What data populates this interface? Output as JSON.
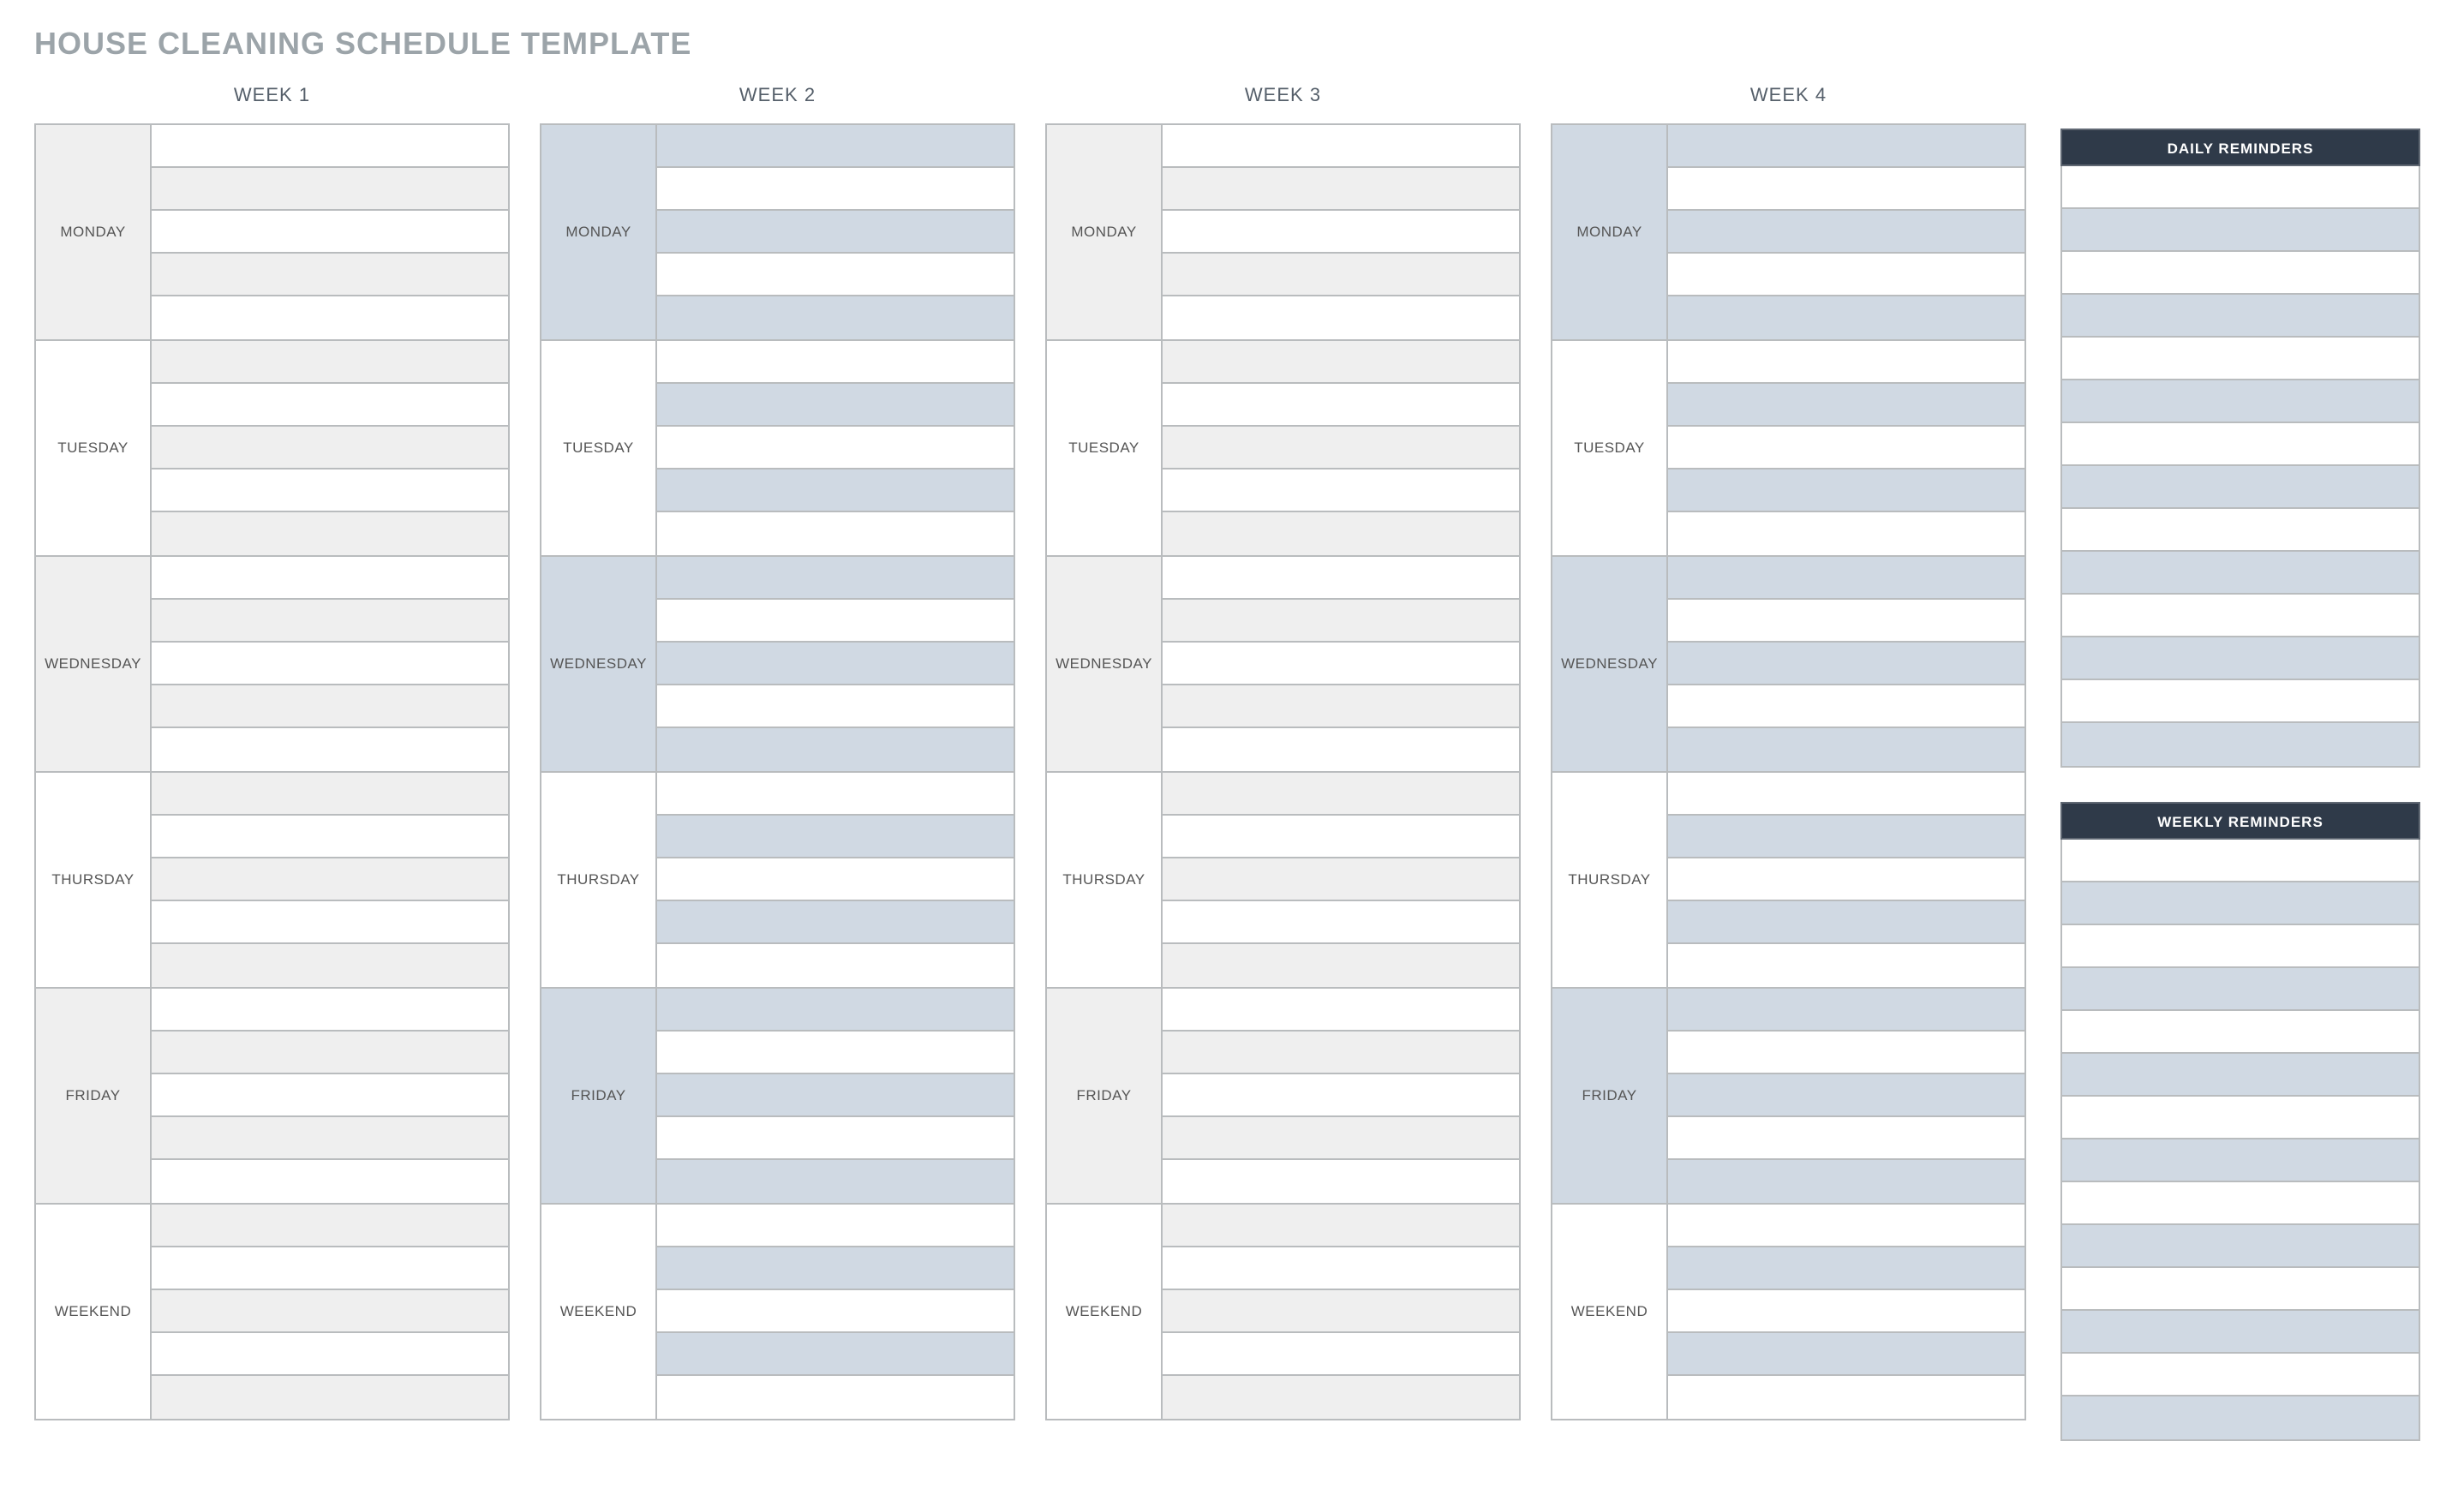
{
  "title": "HOUSE CLEANING SCHEDULE TEMPLATE",
  "days": [
    "MONDAY",
    "TUESDAY",
    "WEDNESDAY",
    "THURSDAY",
    "FRIDAY",
    "WEEKEND"
  ],
  "weeks": [
    {
      "label": "WEEK 1",
      "colorA": "gray",
      "colorB": "white"
    },
    {
      "label": "WEEK 2",
      "colorA": "blue",
      "colorB": "white"
    },
    {
      "label": "WEEK 3",
      "colorA": "gray",
      "colorB": "white"
    },
    {
      "label": "WEEK 4",
      "colorA": "blue",
      "colorB": "white"
    }
  ],
  "tasksPerDay": 5,
  "reminders": {
    "daily": {
      "header": "DAILY REMINDERS",
      "rows": 14
    },
    "weekly": {
      "header": "WEEKLY REMINDERS",
      "rows": 14
    }
  }
}
